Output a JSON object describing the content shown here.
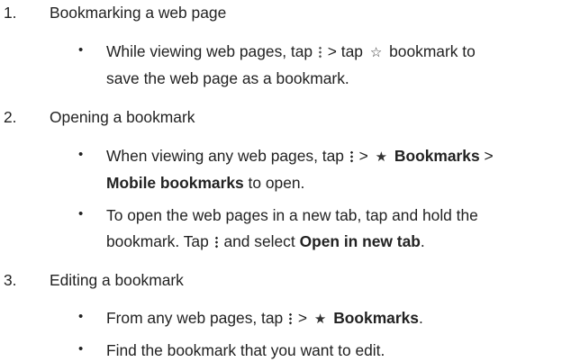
{
  "steps": [
    {
      "number": "1.",
      "title": "Bookmarking a web page",
      "bullets": [
        {
          "line1_before": "While viewing web pages, tap",
          "line1_mid": "> tap",
          "line1_after": "bookmark to",
          "line2": "save the web page as a bookmark."
        }
      ]
    },
    {
      "number": "2.",
      "title": "Opening a bookmark",
      "bullets": [
        {
          "line1_before": "When viewing any web pages, tap",
          "line1_gt": ">",
          "line1_bold": "Bookmarks",
          "line1_after": ">",
          "line2_bold": "Mobile bookmarks",
          "line2_after": "to open."
        },
        {
          "line1": "To open the web pages in a new tab, tap and hold the",
          "line2_before": "bookmark. Tap",
          "line2_mid": "and select",
          "line2_bold": "Open in new tab",
          "line2_after": "."
        }
      ]
    },
    {
      "number": "3.",
      "title": "Editing a bookmark",
      "bullets": [
        {
          "before": "From any web pages, tap",
          "gt": ">",
          "bold": "Bookmarks",
          "after": "."
        },
        {
          "text": "Find the bookmark that you want to edit."
        }
      ]
    }
  ],
  "bullet_char": "•",
  "icons": {
    "menu": "vertical-ellipsis-icon",
    "star_outline": "star-outline-icon",
    "star_filled": "star-filled-icon"
  }
}
